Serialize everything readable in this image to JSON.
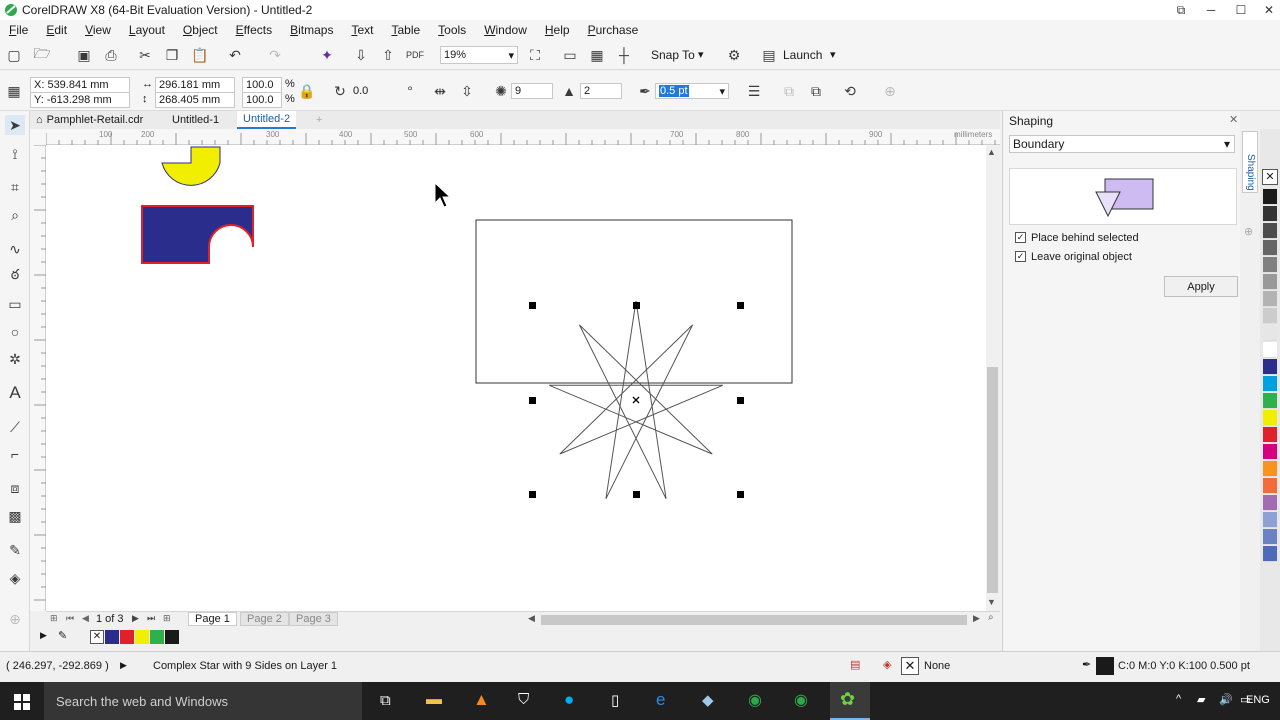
{
  "window": {
    "title": "CorelDRAW X8 (64-Bit Evaluation Version) - Untitled-2"
  },
  "menu": [
    "File",
    "Edit",
    "View",
    "Layout",
    "Object",
    "Effects",
    "Bitmaps",
    "Text",
    "Table",
    "Tools",
    "Window",
    "Help",
    "Purchase"
  ],
  "toolbar": {
    "zoom": "19%",
    "snap_to": "Snap To",
    "launch": "Launch"
  },
  "property_bar": {
    "x": "X: 539.841 mm",
    "y": "Y: -613.298 mm",
    "width": "296.181 mm",
    "height": "268.405 mm",
    "scale_w": "100.0",
    "scale_h": "100.0",
    "pct": "%",
    "rotation": "0.0",
    "points": "9",
    "sharpness": "2",
    "outline_width": "0.5 pt"
  },
  "doc_tabs": [
    "Pamphlet-Retail.cdr",
    "Untitled-1",
    "Untitled-2"
  ],
  "ruler": {
    "h_ticks": [
      "100",
      "200",
      "300",
      "400",
      "500",
      "600",
      "700",
      "800",
      "900"
    ],
    "unit": "millimeters"
  },
  "pages": {
    "counter": "1 of 3",
    "tabs": [
      "Page 1",
      "Page 2",
      "Page 3"
    ]
  },
  "status": {
    "coords": "( 246.297, -292.869 )",
    "message": "Complex Star with 9 Sides on Layer 1",
    "fill": "None",
    "outline": "C:0 M:0 Y:0 K:100  0.500 pt"
  },
  "docker": {
    "title": "Shaping",
    "vertical_tab": "Shaping",
    "mode": "Boundary",
    "options": [
      {
        "label": "Place behind selected",
        "checked": true
      },
      {
        "label": "Leave original object",
        "checked": true
      }
    ],
    "apply": "Apply"
  },
  "taskbar": {
    "search": "Search the web and Windows",
    "lang": "ENG"
  },
  "colors": {
    "navy": "#2b2d8c",
    "red_outline": "#e0202a",
    "yellow": "#f2ee00",
    "accent": "#1f7bd6"
  }
}
